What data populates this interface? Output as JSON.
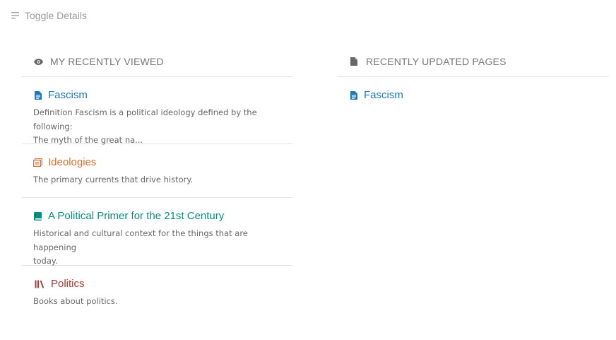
{
  "toggle": {
    "label": "Toggle Details",
    "icon": "toggle-lines-icon"
  },
  "colors": {
    "page": "#1a78b8",
    "chapter": "#e06f2f",
    "book": "#06907e",
    "shelf": "#a93a34",
    "muted": "#777777"
  },
  "recently_viewed": {
    "title": "MY RECENTLY VIEWED",
    "icon": "eye-icon",
    "items": [
      {
        "type": "page",
        "icon": "page-icon",
        "title": "Fascism",
        "excerpt_line1": "Definition Fascism is a political ideology defined by the following:",
        "excerpt_line2": "The myth of the great na..."
      },
      {
        "type": "chapter",
        "icon": "chapter-icon",
        "title": "Ideologies",
        "excerpt_line1": "The primary currents that drive history."
      },
      {
        "type": "book",
        "icon": "book-icon",
        "title": "A Political Primer for the 21st Century",
        "excerpt_line1": "Historical and cultural context for the things that are happening",
        "excerpt_line2": "today."
      },
      {
        "type": "shelf",
        "icon": "bookshelf-icon",
        "title": "Politics",
        "excerpt_line1": "Books about politics."
      }
    ]
  },
  "recently_updated": {
    "title": "RECENTLY UPDATED PAGES",
    "icon": "document-icon",
    "items": [
      {
        "type": "page",
        "icon": "page-icon",
        "title": "Fascism"
      }
    ]
  }
}
